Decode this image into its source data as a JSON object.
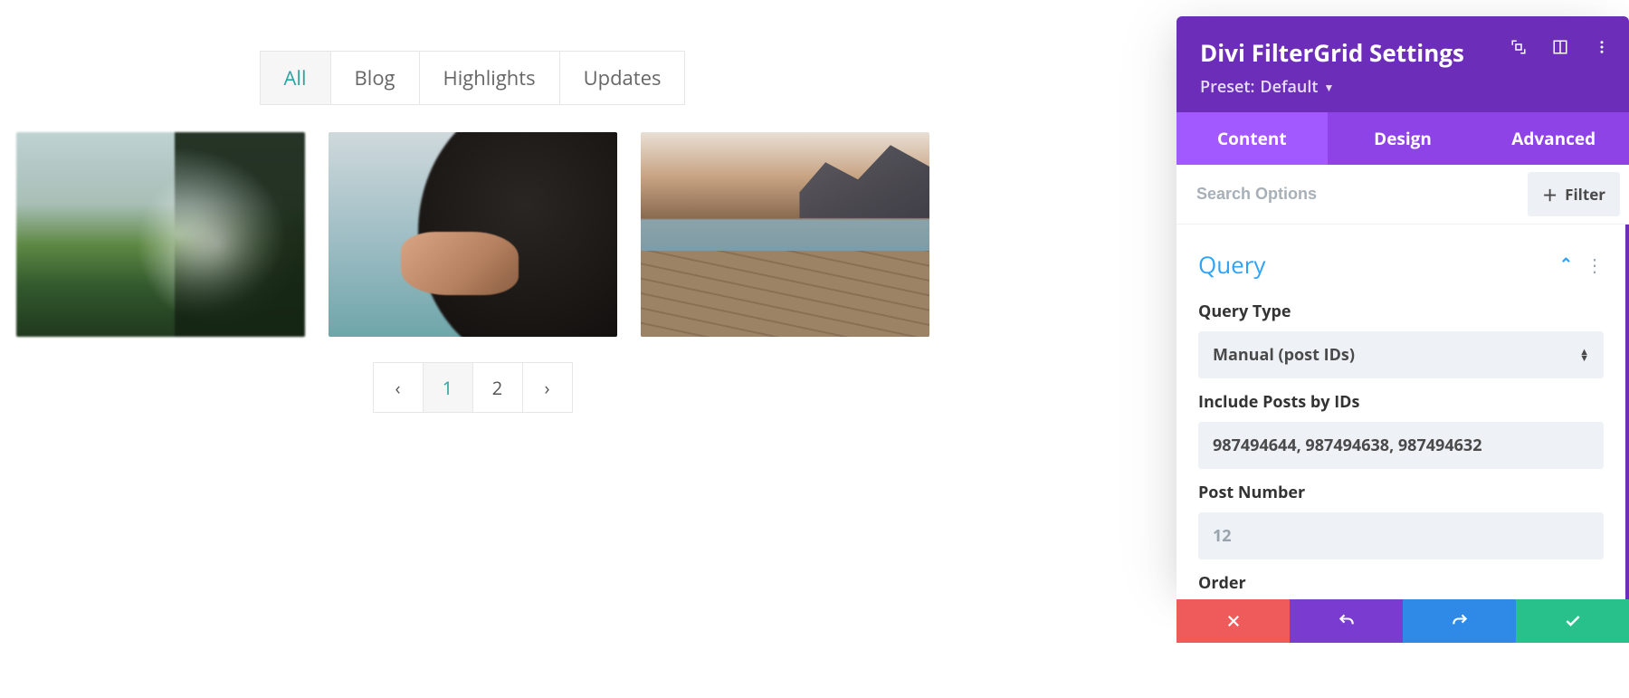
{
  "filters": {
    "items": [
      "All",
      "Blog",
      "Highlights",
      "Updates"
    ],
    "active": "All"
  },
  "pager": {
    "pages": [
      "1",
      "2"
    ],
    "active": "1"
  },
  "panel": {
    "title": "Divi FilterGrid Settings",
    "preset_label": "Preset:",
    "preset_value": "Default",
    "tabs": {
      "content": "Content",
      "design": "Design",
      "advanced": "Advanced"
    },
    "search_placeholder": "Search Options",
    "filter_button": "Filter",
    "section": {
      "title": "Query"
    },
    "fields": {
      "query_type": {
        "label": "Query Type",
        "value": "Manual (post IDs)"
      },
      "include_ids": {
        "label": "Include Posts by IDs",
        "value": "987494644, 987494638, 987494632"
      },
      "post_number": {
        "label": "Post Number",
        "placeholder": "12"
      },
      "order": {
        "label": "Order"
      }
    }
  }
}
